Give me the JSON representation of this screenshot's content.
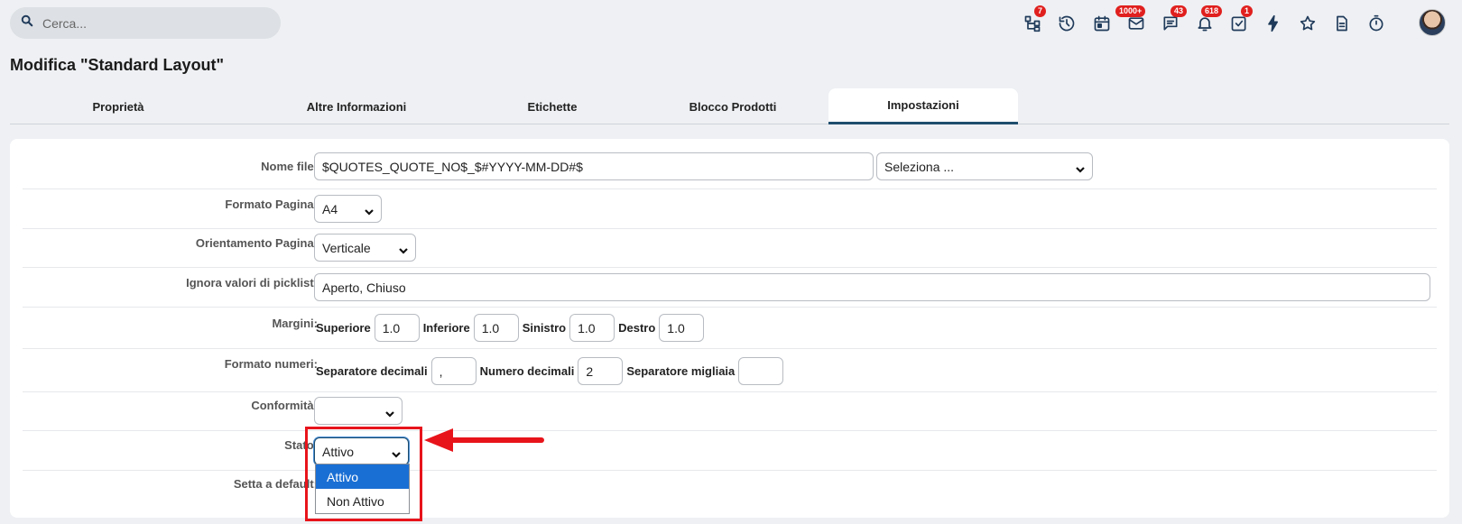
{
  "search": {
    "placeholder": "Cerca..."
  },
  "topbar": {
    "badges": {
      "structure": "7",
      "mail": "1000+",
      "chat": "43",
      "notifications": "618",
      "tasks": "1"
    }
  },
  "page": {
    "title": "Modifica \"Standard Layout\""
  },
  "tabs": [
    {
      "label": "Proprietà"
    },
    {
      "label": "Altre Informazioni"
    },
    {
      "label": "Etichette"
    },
    {
      "label": "Blocco Prodotti"
    },
    {
      "label": "Impostazioni"
    }
  ],
  "form": {
    "filename": {
      "label": "Nome file:",
      "value": "$QUOTES_QUOTE_NO$_$#YYYY-MM-DD#$",
      "select": "Seleziona ..."
    },
    "page_format": {
      "label": "Formato Pagina:",
      "value": "A4"
    },
    "orientation": {
      "label": "Orientamento Pagina:",
      "value": "Verticale"
    },
    "ignore_picklist": {
      "label": "Ignora valori di picklist:",
      "value": "Aperto, Chiuso"
    },
    "margins": {
      "label": "Margini:",
      "top_label": "Superiore",
      "top": "1.0",
      "bottom_label": "Inferiore",
      "bottom": "1.0",
      "left_label": "Sinistro",
      "left": "1.0",
      "right_label": "Destro",
      "right": "1.0"
    },
    "number_format": {
      "label": "Formato numeri:",
      "dec_sep_label": "Separatore decimali",
      "dec_sep": ",",
      "decimals_label": "Numero decimali",
      "decimals": "2",
      "thousands_label": "Separatore migliaia",
      "thousands": ""
    },
    "compliance": {
      "label": "Conformità:",
      "value": ""
    },
    "status": {
      "label": "Stato:",
      "value": "Attivo",
      "options": [
        "Attivo",
        "Non Attivo"
      ]
    },
    "set_default": {
      "label": "Setta a default:"
    }
  },
  "colors": {
    "accent": "#1f4e6e",
    "highlight": "#e8141b",
    "badge": "#e0201e",
    "option_selected": "#1a6fd4"
  }
}
